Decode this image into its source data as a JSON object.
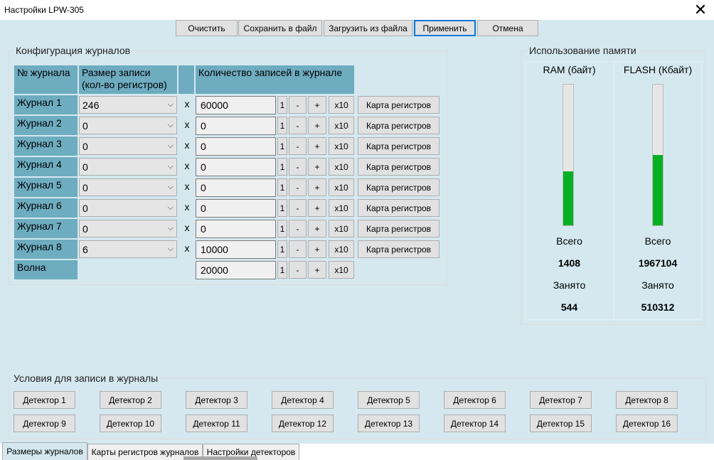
{
  "window": {
    "title": "Настройки LPW-305",
    "close_glyph": "✕"
  },
  "toolbar": {
    "clear": "Очистить",
    "save_file": "Сохранить в файл",
    "load_file": "Загрузить из файла",
    "apply": "Применить",
    "cancel": "Отмена"
  },
  "journals_group": {
    "title": "Конфигурация журналов",
    "col_num": "№ журнала",
    "col_size": "Размер записи\n(кол-во регистров)",
    "col_count": "Количество записей в журнале",
    "x_sign": "x",
    "step_labels": [
      "1",
      "-",
      "+",
      "x10"
    ],
    "map_button": "Карта регистров",
    "rows": [
      {
        "label": "Журнал 1",
        "size": "246",
        "count": "60000"
      },
      {
        "label": "Журнал 2",
        "size": "0",
        "count": "0"
      },
      {
        "label": "Журнал 3",
        "size": "0",
        "count": "0"
      },
      {
        "label": "Журнал 4",
        "size": "0",
        "count": "0"
      },
      {
        "label": "Журнал 5",
        "size": "0",
        "count": "0"
      },
      {
        "label": "Журнал 6",
        "size": "0",
        "count": "0"
      },
      {
        "label": "Журнал 7",
        "size": "0",
        "count": "0"
      },
      {
        "label": "Журнал 8",
        "size": "6",
        "count": "10000"
      }
    ],
    "wave": {
      "label": "Волна",
      "count": "20000"
    }
  },
  "memory_group": {
    "title": "Использование памяти",
    "ram": {
      "header": "RAM (байт)",
      "total_label": "Всего",
      "total": "1408",
      "used_label": "Занято",
      "used": "544",
      "fill_fraction": 0.386
    },
    "flash": {
      "header": "FLASH (Кбайт)",
      "total_label": "Всего",
      "total": "1967104",
      "used_label": "Занято",
      "used": "510312",
      "fill_fraction": 0.5
    },
    "bar_color": "#06b025"
  },
  "conditions_group": {
    "title": "Условия для записи в журналы",
    "detectors": [
      "Детектор 1",
      "Детектор 2",
      "Детектор 3",
      "Детектор 4",
      "Детектор 5",
      "Детектор 6",
      "Детектор 7",
      "Детектор 8",
      "Детектор 9",
      "Детектор 10",
      "Детектор 11",
      "Детектор 12",
      "Детектор 13",
      "Детектор 14",
      "Детектор 15",
      "Детектор 16"
    ]
  },
  "tabs": [
    "Размеры журналов",
    "Карты регистров журналов",
    "Настройки детекторов"
  ],
  "colors": {
    "background": "#d5e8f0",
    "header_cell": "#6eacc0",
    "accent": "#0078d7"
  }
}
